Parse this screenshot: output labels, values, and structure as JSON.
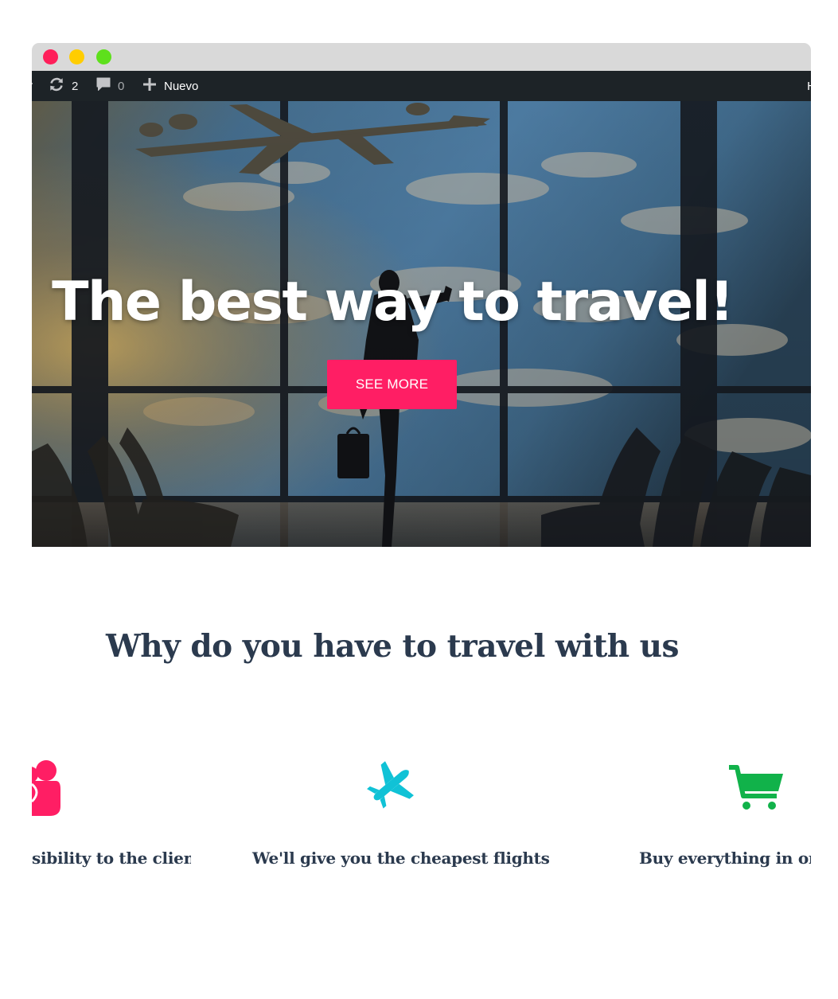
{
  "admin_bar": {
    "updates_count": "2",
    "comments_count": "0",
    "new_label": "Nuevo",
    "right_edge_text": "H"
  },
  "hero": {
    "title": "The best way to travel!",
    "button_label": "SEE MORE"
  },
  "features_section": {
    "title": "Why do you have to travel with us",
    "items": [
      {
        "icon": "users-icon",
        "text": "sibility to the client",
        "icon_color": "#ff1e64"
      },
      {
        "icon": "airplane-icon",
        "text": "We'll give you the cheapest flights",
        "icon_color": "#10c2d6"
      },
      {
        "icon": "shopping-cart-icon",
        "text": "Buy everything in on",
        "icon_color": "#11b24a"
      }
    ]
  },
  "colors": {
    "accent": "#ff1e64",
    "admin_bar_bg": "#1d2327",
    "heading": "#2b3a4e",
    "window_close": "#ff1f5a",
    "window_minimize": "#ffcd00",
    "window_zoom": "#5ee01c"
  }
}
